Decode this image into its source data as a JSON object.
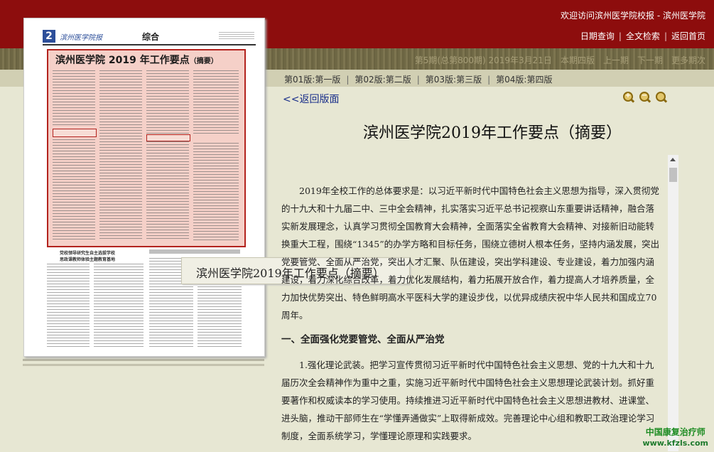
{
  "header": {
    "welcome": "欢迎访问滨州医学院校报 - 滨州医学院",
    "links": [
      "日期查询",
      "全文检索",
      "返回首页"
    ]
  },
  "issue_info": {
    "issue": "第5期(总第800期) 2019年3月21日",
    "page_count": "本期四版",
    "prev": "上一期",
    "next": "下一期",
    "more": "更多期次"
  },
  "page_tabs": [
    "第01版:第一版",
    "第02版:第二版",
    "第03版:第三版",
    "第04版:第四版"
  ],
  "thumbnail": {
    "page_num": "2",
    "masthead": "滨州医学院报",
    "section": "综合",
    "headline": "滨州医学院 2019 年工作要点",
    "headline_suffix": "（摘要）",
    "lower_headline": "党校领导研究生自主选拔学校\n思政课教师体验主题教育基地"
  },
  "tooltip": "滨州医学院2019年工作要点（摘要）",
  "article": {
    "back_label": "<<返回版面",
    "title": "滨州医学院2019年工作要点（摘要）",
    "paragraph1": "2019年全校工作的总体要求是：以习近平新时代中国特色社会主义思想为指导，深入贯彻党的十九大和十九届二中、三中全会精神，扎实落实习近平总书记视察山东重要讲话精神，融合落实新发展理念，认真学习贯彻全国教育大会精神，全面落实全省教育大会精神、对接新旧动能转换重大工程，围绕“1345”的办学方略和目标任务，围绕立德树人根本任务，坚持内涵发展，突出党要管党、全面从严治党，突出人才汇聚、队伍建设，突出学科建设、专业建设，着力加强内涵建设，着力深化综合改革，着力优化发展结构，着力拓展开放合作，着力提高人才培养质量，全力加快优势突出、特色鲜明高水平医科大学的建设步伐，以优异成绩庆祝中华人民共和国成立70周年。",
    "section1": "一、全面强化党要管党、全面从严治党",
    "paragraph2": "1.强化理论武装。把学习宣传贯彻习近平新时代中国特色社会主义思想、党的十九大和十九届历次全会精神作为重中之重，实施习近平新时代中国特色社会主义思想理论武装计划。抓好重要著作和权威读本的学习使用。持续推进习近平新时代中国特色社会主义思想进教材、进课堂、进头脑，推动干部师生在“学懂弄通做实”上取得新成效。完善理论中心组和教职工政治理论学习制度，全面系统学习，学懂理论原理和实践要求。"
  },
  "watermark": {
    "name": "中国康复治疗师",
    "url": "www.kfzls.com"
  },
  "colors": {
    "header_red": "#8d0d0d",
    "link_blue": "#1a2f8a",
    "highlight_border": "#b3231e"
  },
  "icons": [
    "zoom-in-icon",
    "zoom-out-icon",
    "zoom-reset-icon"
  ]
}
